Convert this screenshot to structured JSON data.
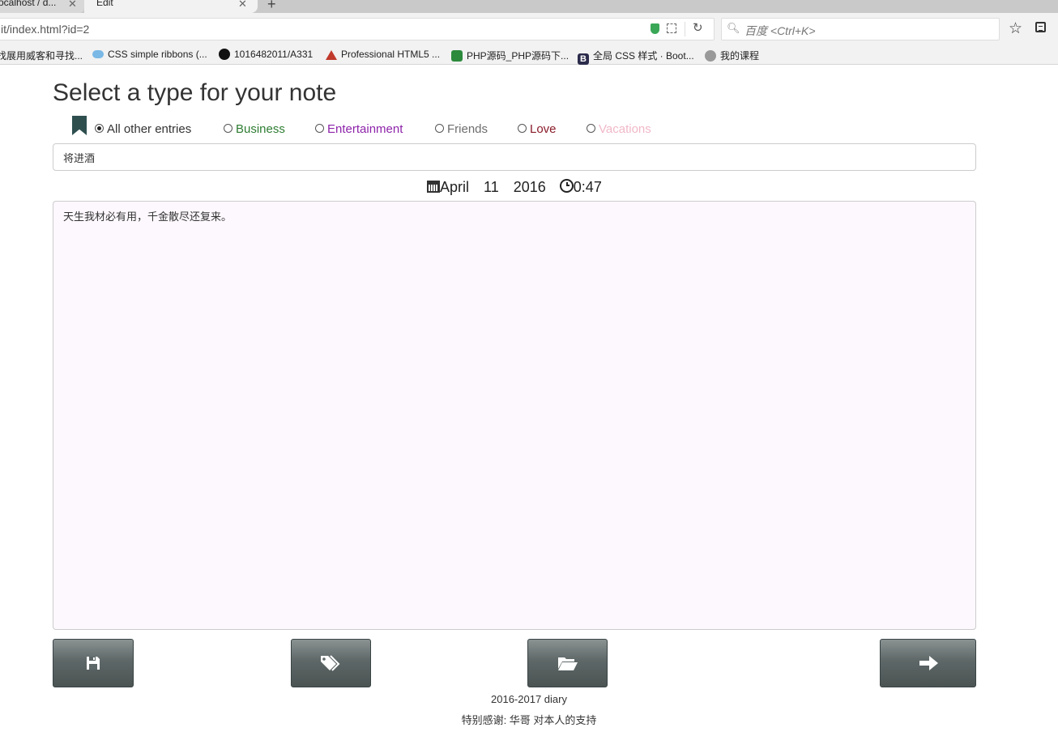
{
  "browser": {
    "tabs": [
      {
        "label": "ocalhost / d...",
        "close": "✕"
      },
      {
        "label": "Edit",
        "close": "✕"
      }
    ],
    "new_tab": "+",
    "url": "it/index.html?id=2",
    "search_placeholder": "百度 <Ctrl+K>",
    "bookmarks": [
      {
        "label": "找展用威客和寻找..."
      },
      {
        "label": "CSS simple ribbons (..."
      },
      {
        "label": "1016482011/A331"
      },
      {
        "label": "Professional HTML5 ..."
      },
      {
        "label": "PHP源码_PHP源码下..."
      },
      {
        "label": "全局 CSS 样式 · Boot..."
      },
      {
        "label": "我的课程"
      }
    ]
  },
  "page": {
    "title": "Select a type for your note",
    "types": [
      {
        "label": "All other entries",
        "color": "#333333",
        "checked": true
      },
      {
        "label": "Business",
        "color": "#2e7d32",
        "checked": false
      },
      {
        "label": "Entertainment",
        "color": "#8e24aa",
        "checked": false
      },
      {
        "label": "Friends",
        "color": "#6d6d6d",
        "checked": false
      },
      {
        "label": "Love",
        "color": "#8a1c2b",
        "checked": false
      },
      {
        "label": "Vacations",
        "color": "#f0b8c8",
        "checked": false
      }
    ],
    "note_title": "将进酒",
    "date": {
      "month": "April",
      "day": "11",
      "year": "2016",
      "time": "0:47"
    },
    "content": "天生我材必有用，千金散尽还复来。",
    "buttons": [
      {
        "name": "save",
        "icon": "floppy-disk-icon"
      },
      {
        "name": "tags",
        "icon": "tags-icon"
      },
      {
        "name": "open",
        "icon": "folder-open-icon"
      },
      {
        "name": "next",
        "icon": "arrow-right-icon"
      }
    ]
  },
  "footer": {
    "line1": "2016-2017 diary",
    "line2": "特别感谢: 华哥 对本人的支持"
  }
}
